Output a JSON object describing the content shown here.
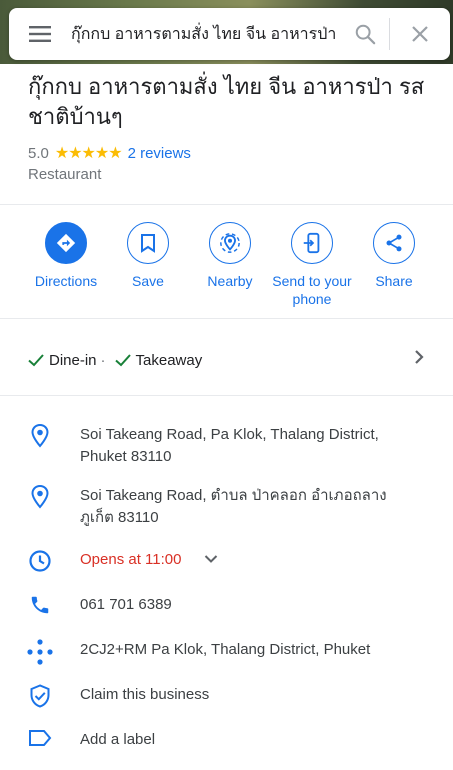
{
  "search": {
    "query": "กุ๊กกบ อาหารตามสั่ง ไทย จีน อาหารป่า"
  },
  "place": {
    "name": "กุ๊กกบ อาหารตามสั่ง ไทย จีน อาหารป่า รส ชาติบ้านๆ",
    "rating": "5.0",
    "stars": "★★★★★",
    "reviews": "2 reviews",
    "category": "Restaurant"
  },
  "actions": [
    {
      "label": "Directions",
      "icon": "directions-icon"
    },
    {
      "label": "Save",
      "icon": "bookmark-icon"
    },
    {
      "label": "Nearby",
      "icon": "nearby-icon"
    },
    {
      "label": "Send to your phone",
      "icon": "send-to-phone-icon"
    },
    {
      "label": "Share",
      "icon": "share-icon"
    }
  ],
  "service_options": {
    "dine_in": "Dine-in",
    "separator": "·",
    "takeaway": "Takeaway"
  },
  "info": {
    "address_en": "Soi Takeang Road, Pa Klok, Thalang District, Phuket 83110",
    "address_th": "Soi Takeang Road, ตำบล ป่าคลอก อำเภอถลาง ภูเก็ต 83110",
    "hours": "Opens at 11:00",
    "phone": "061 701 6389",
    "plus_code": "2CJ2+RM Pa Klok, Thalang District, Phuket",
    "claim": "Claim this business",
    "label": "Add a label"
  },
  "colors": {
    "accent": "#1a73e8",
    "star": "#fbbc04",
    "open_status": "#d93025",
    "check": "#188038"
  }
}
